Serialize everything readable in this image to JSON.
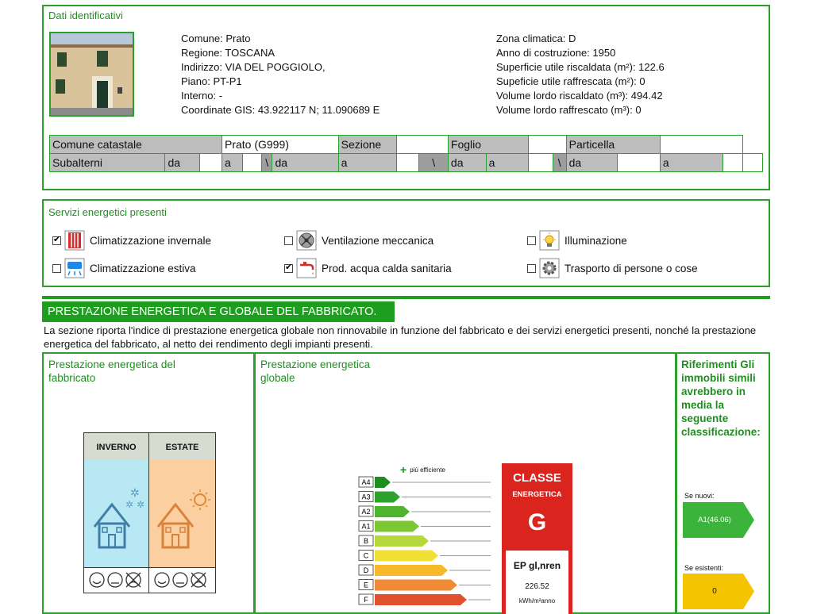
{
  "identification": {
    "title": "Dati identificativi",
    "left_lines": [
      "Comune: Prato",
      "Regione: TOSCANA",
      "Indirizzo: VIA DEL POGGIOLO,",
      "Piano: PT-P1",
      "Interno: -",
      "Coordinate GIS: 43.922117 N; 11.090689 E"
    ],
    "right_lines": [
      "Zona climatica: D",
      "Anno di costruzione: 1950",
      "Superficie utile riscaldata (m²): 122.6",
      "Supeficie utile raffrescata (m²): 0",
      "Volume lordo riscaldato (m³): 494.42",
      "Volume lordo raffrescato (m³): 0"
    ]
  },
  "cadastre": {
    "comune_label": "Comune catastale",
    "comune_value": "Prato (G999)",
    "sezione_label": "Sezione",
    "foglio_label": "Foglio",
    "particella_label": "Particella",
    "subalterni_label": "Subalterni",
    "da": "da",
    "a": "a",
    "slash": "\\"
  },
  "services": {
    "title": "Servizi energetici presenti",
    "items": [
      {
        "label": "Climatizzazione invernale",
        "checked": true,
        "icon": "radiator-icon"
      },
      {
        "label": "Ventilazione meccanica",
        "checked": false,
        "icon": "fan-icon"
      },
      {
        "label": "Illuminazione",
        "checked": false,
        "icon": "lightbulb-icon"
      },
      {
        "label": "Climatizzazione estiva",
        "checked": false,
        "icon": "air-conditioner-icon"
      },
      {
        "label": "Prod. acqua calda sanitaria",
        "checked": true,
        "icon": "faucet-icon"
      },
      {
        "label": "Trasporto di persone o cose",
        "checked": false,
        "icon": "gear-icon"
      }
    ]
  },
  "performance": {
    "section_title": "PRESTAZIONE ENERGETICA E GLOBALE DEL FABBRICATO.",
    "description": "La sezione riporta l'indice di prestazione energetica globale non rinnovabile in funzione del fabbricato e dei servizi energetici presenti, nonché la prestazione energetica del fabbricato, al netto dei rendimento degli impianti presenti.",
    "building_panel_title": "Prestazione energetica del fabbricato",
    "global_panel_title": "Prestazione energetica globale",
    "references_title": "Riferimenti Gli immobili simili avrebbero in media la seguente classificazione:",
    "season_winter": "INVERNO",
    "season_summer": "ESTATE",
    "more_efficient": "più efficiente",
    "classes": [
      "A4",
      "A3",
      "A2",
      "A1",
      "B",
      "C",
      "D",
      "E",
      "F"
    ],
    "class_colors": [
      "#1b8f1b",
      "#2fa12f",
      "#4fb52f",
      "#7dc832",
      "#b7d83a",
      "#f1e035",
      "#f7b82a",
      "#f08a34",
      "#e0522d"
    ],
    "classe_label": "CLASSE",
    "energetica_label": "ENERGETICA",
    "classe_value": "G",
    "ep_label": "EP gl,nren",
    "ep_value": "226.52",
    "ep_unit": "kWh/m²anno",
    "new_label": "Se nuovi:",
    "new_value": "A1(46.06)",
    "existing_label": "Se esistenti:",
    "existing_value": "0"
  }
}
